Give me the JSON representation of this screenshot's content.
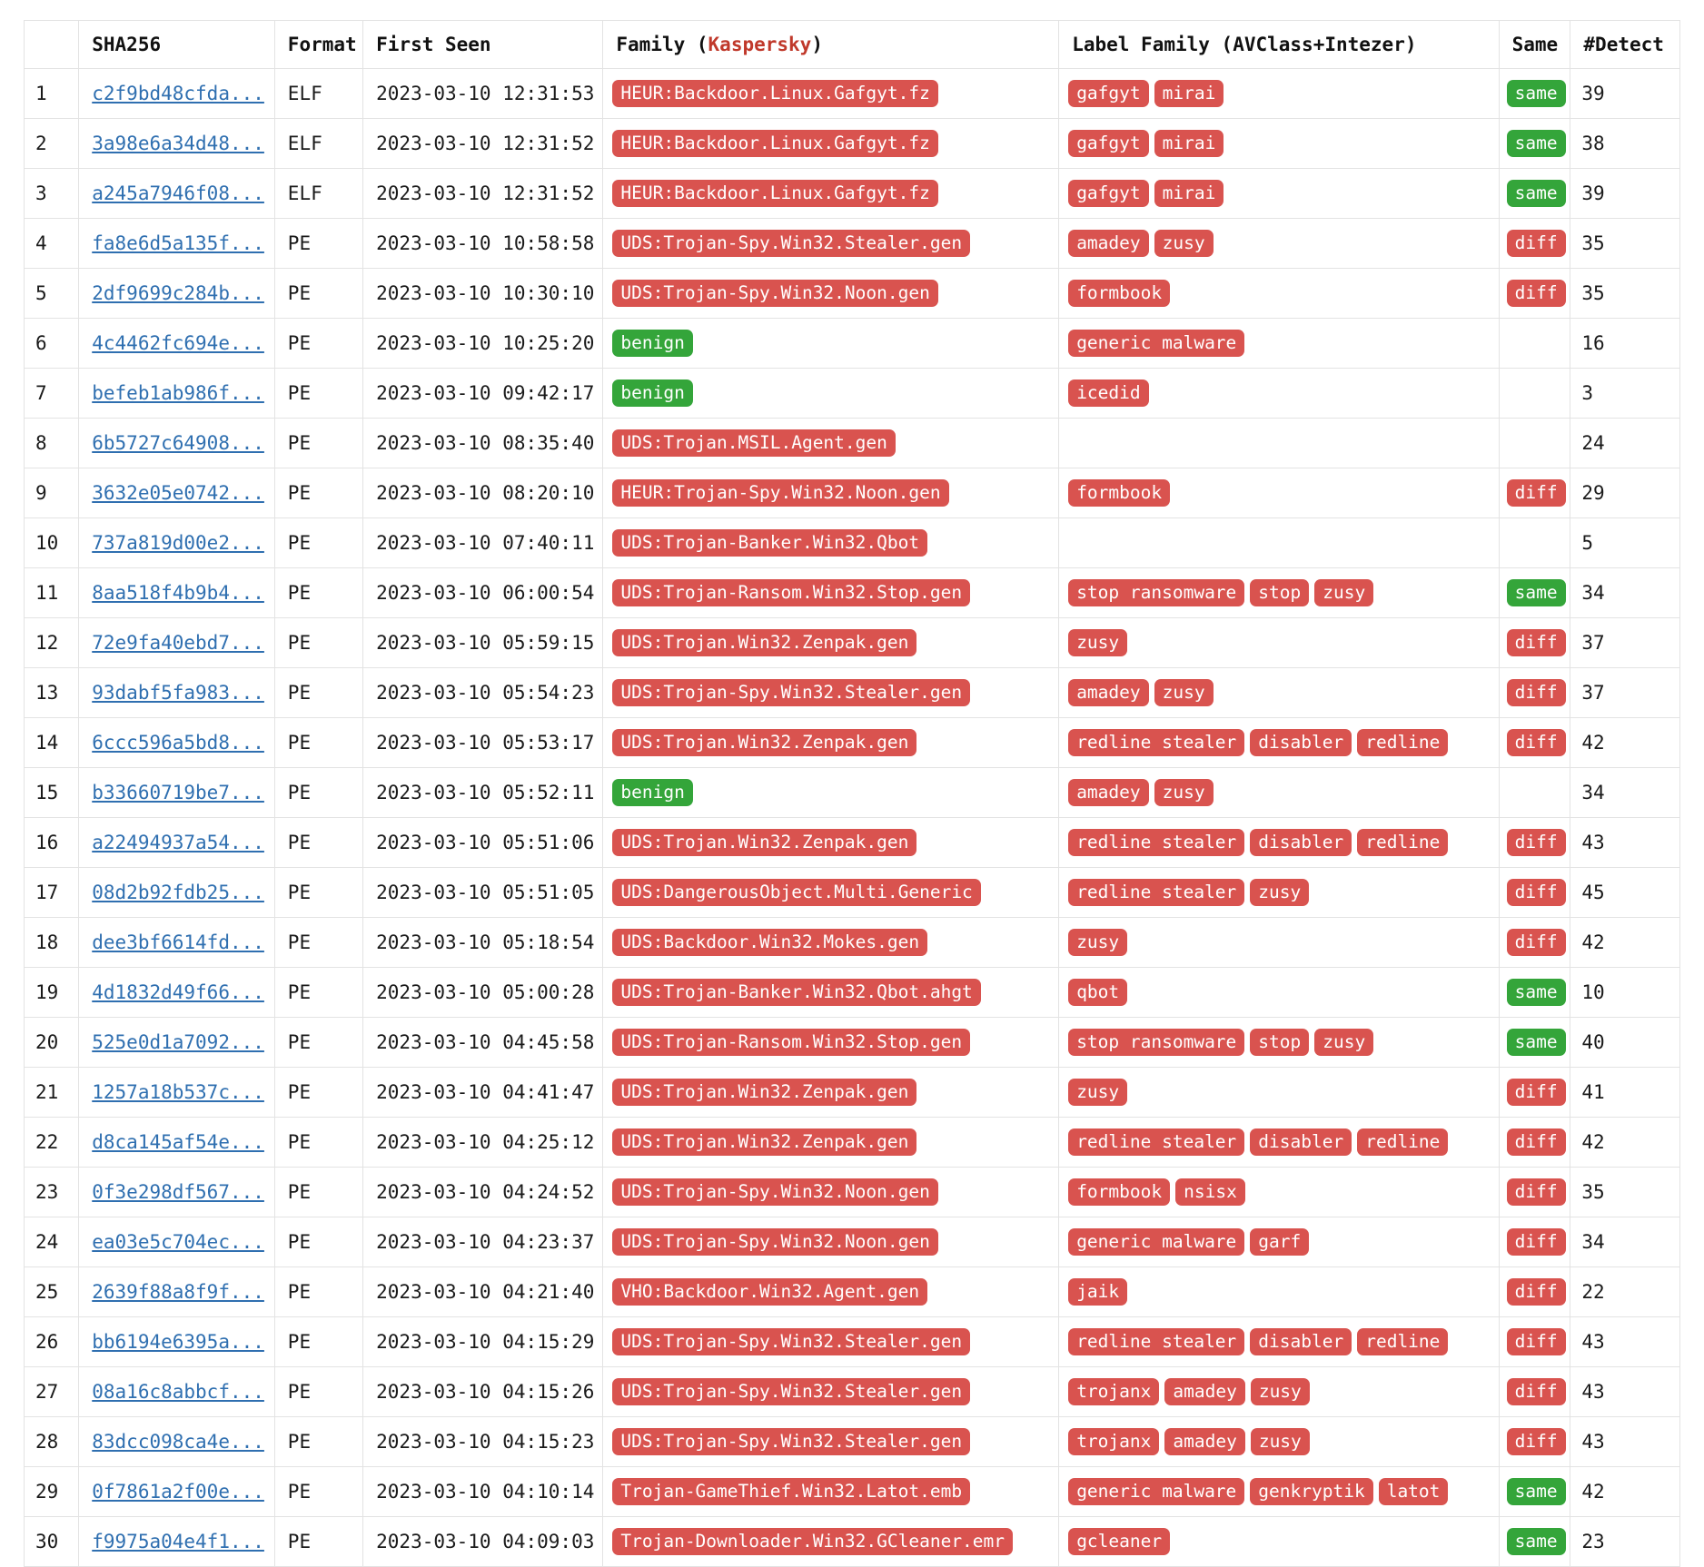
{
  "table": {
    "columns": [
      {
        "key": "index",
        "label": ""
      },
      {
        "key": "sha256",
        "label": "SHA256"
      },
      {
        "key": "format",
        "label": "Format"
      },
      {
        "key": "first_seen",
        "label": "First Seen"
      },
      {
        "key": "family",
        "label": "Family (",
        "vendor": "Kaspersky",
        "label_suffix": ")"
      },
      {
        "key": "label_family",
        "label": "Label Family (AVClass+Intezer)"
      },
      {
        "key": "same",
        "label": "Same"
      },
      {
        "key": "detect",
        "label": "#Detect"
      }
    ],
    "colors": {
      "badge_red": "#d9534f",
      "badge_green": "#34a53a",
      "link": "#2f6fb0",
      "vendor_accent": "#c0392b",
      "border": "#e3e3e3"
    },
    "rows": [
      {
        "index": "1",
        "sha256": "c2f9bd48cfda...",
        "format": "ELF",
        "first_seen": "2023-03-10 12:31:53",
        "family": "HEUR:Backdoor.Linux.Gafgyt.fz",
        "family_kind": "malicious",
        "label_family": [
          "gafgyt",
          "mirai"
        ],
        "same": "same",
        "detect": "39"
      },
      {
        "index": "2",
        "sha256": "3a98e6a34d48...",
        "format": "ELF",
        "first_seen": "2023-03-10 12:31:52",
        "family": "HEUR:Backdoor.Linux.Gafgyt.fz",
        "family_kind": "malicious",
        "label_family": [
          "gafgyt",
          "mirai"
        ],
        "same": "same",
        "detect": "38"
      },
      {
        "index": "3",
        "sha256": "a245a7946f08...",
        "format": "ELF",
        "first_seen": "2023-03-10 12:31:52",
        "family": "HEUR:Backdoor.Linux.Gafgyt.fz",
        "family_kind": "malicious",
        "label_family": [
          "gafgyt",
          "mirai"
        ],
        "same": "same",
        "detect": "39"
      },
      {
        "index": "4",
        "sha256": "fa8e6d5a135f...",
        "format": "PE",
        "first_seen": "2023-03-10 10:58:58",
        "family": "UDS:Trojan-Spy.Win32.Stealer.gen",
        "family_kind": "malicious",
        "label_family": [
          "amadey",
          "zusy"
        ],
        "same": "diff",
        "detect": "35"
      },
      {
        "index": "5",
        "sha256": "2df9699c284b...",
        "format": "PE",
        "first_seen": "2023-03-10 10:30:10",
        "family": "UDS:Trojan-Spy.Win32.Noon.gen",
        "family_kind": "malicious",
        "label_family": [
          "formbook"
        ],
        "same": "diff",
        "detect": "35"
      },
      {
        "index": "6",
        "sha256": "4c4462fc694e...",
        "format": "PE",
        "first_seen": "2023-03-10 10:25:20",
        "family": "benign",
        "family_kind": "benign",
        "label_family": [
          "generic malware"
        ],
        "same": "",
        "detect": "16"
      },
      {
        "index": "7",
        "sha256": "befeb1ab986f...",
        "format": "PE",
        "first_seen": "2023-03-10 09:42:17",
        "family": "benign",
        "family_kind": "benign",
        "label_family": [
          "icedid"
        ],
        "same": "",
        "detect": "3"
      },
      {
        "index": "8",
        "sha256": "6b5727c64908...",
        "format": "PE",
        "first_seen": "2023-03-10 08:35:40",
        "family": "UDS:Trojan.MSIL.Agent.gen",
        "family_kind": "malicious",
        "label_family": [],
        "same": "",
        "detect": "24"
      },
      {
        "index": "9",
        "sha256": "3632e05e0742...",
        "format": "PE",
        "first_seen": "2023-03-10 08:20:10",
        "family": "HEUR:Trojan-Spy.Win32.Noon.gen",
        "family_kind": "malicious",
        "label_family": [
          "formbook"
        ],
        "same": "diff",
        "detect": "29"
      },
      {
        "index": "10",
        "sha256": "737a819d00e2...",
        "format": "PE",
        "first_seen": "2023-03-10 07:40:11",
        "family": "UDS:Trojan-Banker.Win32.Qbot",
        "family_kind": "malicious",
        "label_family": [],
        "same": "",
        "detect": "5"
      },
      {
        "index": "11",
        "sha256": "8aa518f4b9b4...",
        "format": "PE",
        "first_seen": "2023-03-10 06:00:54",
        "family": "UDS:Trojan-Ransom.Win32.Stop.gen",
        "family_kind": "malicious",
        "label_family": [
          "stop ransomware",
          "stop",
          "zusy"
        ],
        "same": "same",
        "detect": "34"
      },
      {
        "index": "12",
        "sha256": "72e9fa40ebd7...",
        "format": "PE",
        "first_seen": "2023-03-10 05:59:15",
        "family": "UDS:Trojan.Win32.Zenpak.gen",
        "family_kind": "malicious",
        "label_family": [
          "zusy"
        ],
        "same": "diff",
        "detect": "37"
      },
      {
        "index": "13",
        "sha256": "93dabf5fa983...",
        "format": "PE",
        "first_seen": "2023-03-10 05:54:23",
        "family": "UDS:Trojan-Spy.Win32.Stealer.gen",
        "family_kind": "malicious",
        "label_family": [
          "amadey",
          "zusy"
        ],
        "same": "diff",
        "detect": "37"
      },
      {
        "index": "14",
        "sha256": "6ccc596a5bd8...",
        "format": "PE",
        "first_seen": "2023-03-10 05:53:17",
        "family": "UDS:Trojan.Win32.Zenpak.gen",
        "family_kind": "malicious",
        "label_family": [
          "redline stealer",
          "disabler",
          "redline"
        ],
        "same": "diff",
        "detect": "42"
      },
      {
        "index": "15",
        "sha256": "b33660719be7...",
        "format": "PE",
        "first_seen": "2023-03-10 05:52:11",
        "family": "benign",
        "family_kind": "benign",
        "label_family": [
          "amadey",
          "zusy"
        ],
        "same": "",
        "detect": "34"
      },
      {
        "index": "16",
        "sha256": "a22494937a54...",
        "format": "PE",
        "first_seen": "2023-03-10 05:51:06",
        "family": "UDS:Trojan.Win32.Zenpak.gen",
        "family_kind": "malicious",
        "label_family": [
          "redline stealer",
          "disabler",
          "redline"
        ],
        "same": "diff",
        "detect": "43"
      },
      {
        "index": "17",
        "sha256": "08d2b92fdb25...",
        "format": "PE",
        "first_seen": "2023-03-10 05:51:05",
        "family": "UDS:DangerousObject.Multi.Generic",
        "family_kind": "malicious",
        "label_family": [
          "redline stealer",
          "zusy"
        ],
        "same": "diff",
        "detect": "45"
      },
      {
        "index": "18",
        "sha256": "dee3bf6614fd...",
        "format": "PE",
        "first_seen": "2023-03-10 05:18:54",
        "family": "UDS:Backdoor.Win32.Mokes.gen",
        "family_kind": "malicious",
        "label_family": [
          "zusy"
        ],
        "same": "diff",
        "detect": "42"
      },
      {
        "index": "19",
        "sha256": "4d1832d49f66...",
        "format": "PE",
        "first_seen": "2023-03-10 05:00:28",
        "family": "UDS:Trojan-Banker.Win32.Qbot.ahgt",
        "family_kind": "malicious",
        "label_family": [
          "qbot"
        ],
        "same": "same",
        "detect": "10"
      },
      {
        "index": "20",
        "sha256": "525e0d1a7092...",
        "format": "PE",
        "first_seen": "2023-03-10 04:45:58",
        "family": "UDS:Trojan-Ransom.Win32.Stop.gen",
        "family_kind": "malicious",
        "label_family": [
          "stop ransomware",
          "stop",
          "zusy"
        ],
        "same": "same",
        "detect": "40"
      },
      {
        "index": "21",
        "sha256": "1257a18b537c...",
        "format": "PE",
        "first_seen": "2023-03-10 04:41:47",
        "family": "UDS:Trojan.Win32.Zenpak.gen",
        "family_kind": "malicious",
        "label_family": [
          "zusy"
        ],
        "same": "diff",
        "detect": "41"
      },
      {
        "index": "22",
        "sha256": "d8ca145af54e...",
        "format": "PE",
        "first_seen": "2023-03-10 04:25:12",
        "family": "UDS:Trojan.Win32.Zenpak.gen",
        "family_kind": "malicious",
        "label_family": [
          "redline stealer",
          "disabler",
          "redline"
        ],
        "same": "diff",
        "detect": "42"
      },
      {
        "index": "23",
        "sha256": "0f3e298df567...",
        "format": "PE",
        "first_seen": "2023-03-10 04:24:52",
        "family": "UDS:Trojan-Spy.Win32.Noon.gen",
        "family_kind": "malicious",
        "label_family": [
          "formbook",
          "nsisx"
        ],
        "same": "diff",
        "detect": "35"
      },
      {
        "index": "24",
        "sha256": "ea03e5c704ec...",
        "format": "PE",
        "first_seen": "2023-03-10 04:23:37",
        "family": "UDS:Trojan-Spy.Win32.Noon.gen",
        "family_kind": "malicious",
        "label_family": [
          "generic malware",
          "garf"
        ],
        "same": "diff",
        "detect": "34"
      },
      {
        "index": "25",
        "sha256": "2639f88a8f9f...",
        "format": "PE",
        "first_seen": "2023-03-10 04:21:40",
        "family": "VHO:Backdoor.Win32.Agent.gen",
        "family_kind": "malicious",
        "label_family": [
          "jaik"
        ],
        "same": "diff",
        "detect": "22"
      },
      {
        "index": "26",
        "sha256": "bb6194e6395a...",
        "format": "PE",
        "first_seen": "2023-03-10 04:15:29",
        "family": "UDS:Trojan-Spy.Win32.Stealer.gen",
        "family_kind": "malicious",
        "label_family": [
          "redline stealer",
          "disabler",
          "redline"
        ],
        "same": "diff",
        "detect": "43"
      },
      {
        "index": "27",
        "sha256": "08a16c8abbcf...",
        "format": "PE",
        "first_seen": "2023-03-10 04:15:26",
        "family": "UDS:Trojan-Spy.Win32.Stealer.gen",
        "family_kind": "malicious",
        "label_family": [
          "trojanx",
          "amadey",
          "zusy"
        ],
        "same": "diff",
        "detect": "43"
      },
      {
        "index": "28",
        "sha256": "83dcc098ca4e...",
        "format": "PE",
        "first_seen": "2023-03-10 04:15:23",
        "family": "UDS:Trojan-Spy.Win32.Stealer.gen",
        "family_kind": "malicious",
        "label_family": [
          "trojanx",
          "amadey",
          "zusy"
        ],
        "same": "diff",
        "detect": "43"
      },
      {
        "index": "29",
        "sha256": "0f7861a2f00e...",
        "format": "PE",
        "first_seen": "2023-03-10 04:10:14",
        "family": "Trojan-GameThief.Win32.Latot.emb",
        "family_kind": "malicious",
        "label_family": [
          "generic malware",
          "genkryptik",
          "latot"
        ],
        "same": "same",
        "detect": "42"
      },
      {
        "index": "30",
        "sha256": "f9975a04e4f1...",
        "format": "PE",
        "first_seen": "2023-03-10 04:09:03",
        "family": "Trojan-Downloader.Win32.GCleaner.emr",
        "family_kind": "malicious",
        "label_family": [
          "gcleaner"
        ],
        "same": "same",
        "detect": "23"
      }
    ]
  }
}
